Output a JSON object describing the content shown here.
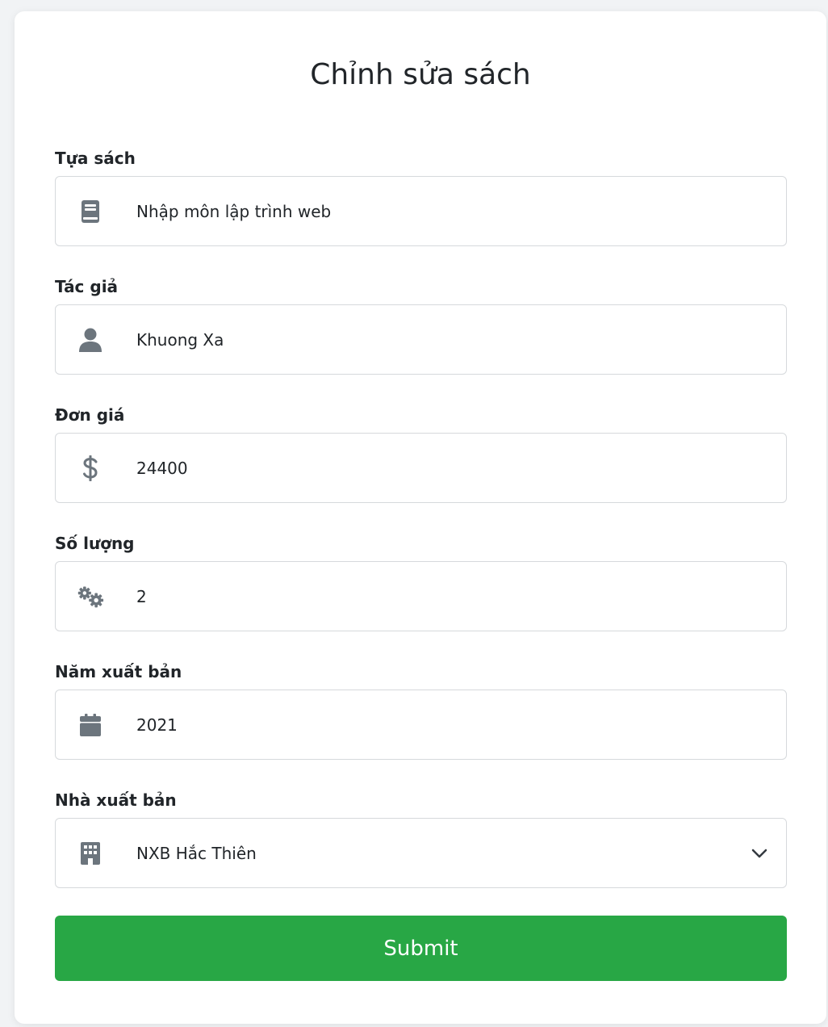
{
  "form": {
    "title": "Chỉnh sửa sách",
    "fields": [
      {
        "label": "Tựa sách",
        "icon": "book-icon",
        "value": "Nhập môn lập trình web"
      },
      {
        "label": "Tác giả",
        "icon": "user-icon",
        "value": "Khuong Xa"
      },
      {
        "label": "Đơn giá",
        "icon": "dollar-icon",
        "value": "24400"
      },
      {
        "label": "Số lượng",
        "icon": "gears-icon",
        "value": "2"
      },
      {
        "label": "Năm xuất bản",
        "icon": "calendar-icon",
        "value": "2021"
      },
      {
        "label": "Nhà xuất bản",
        "icon": "building-icon",
        "value": "NXB Hắc Thiên"
      }
    ],
    "submit_label": "Submit"
  },
  "colors": {
    "accent": "#28a745",
    "icon": "#6c757d",
    "border": "#d6d9dc"
  }
}
